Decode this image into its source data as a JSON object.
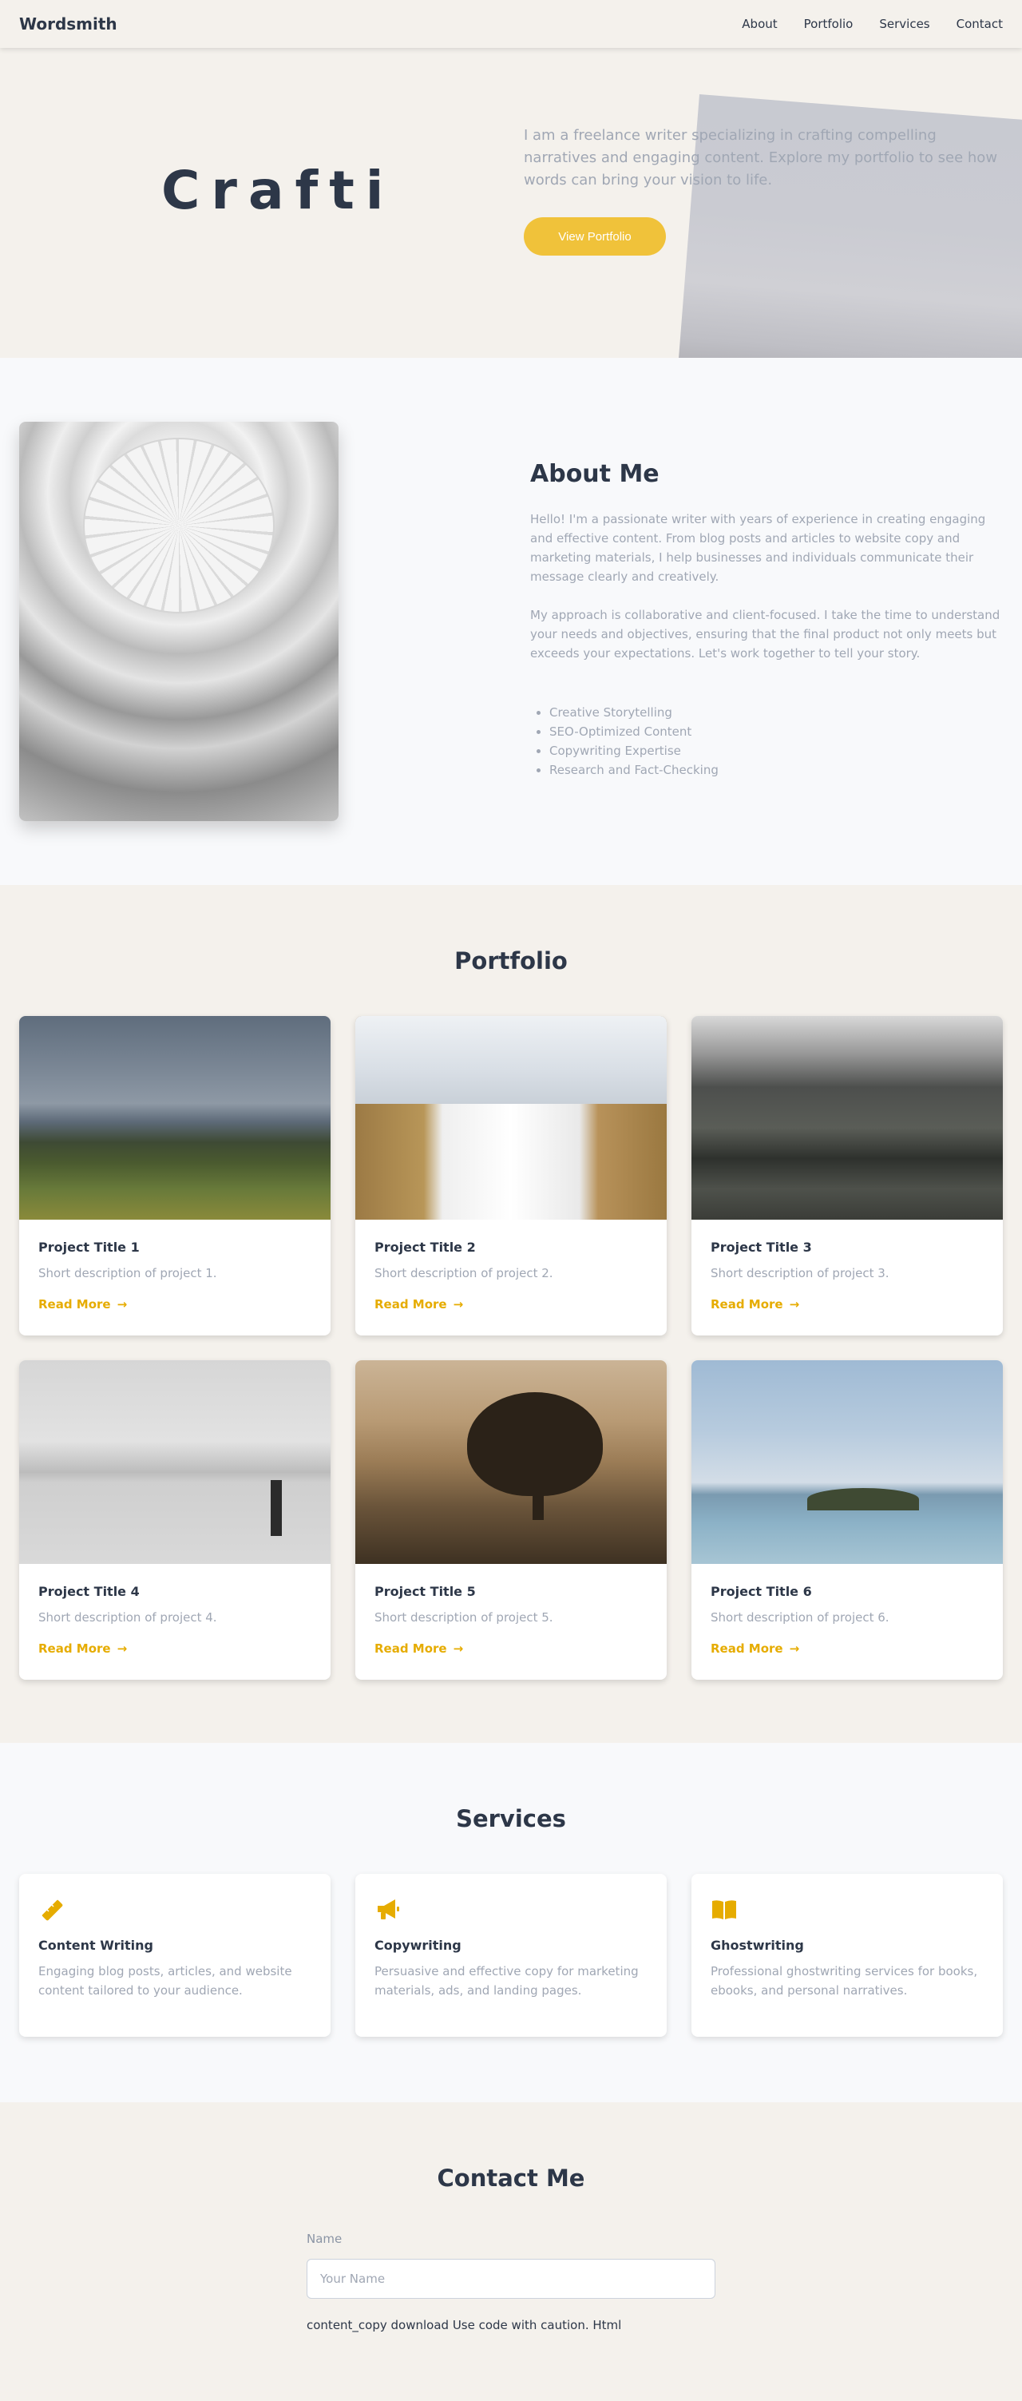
{
  "nav": {
    "brand": "Wordsmith",
    "links": [
      "About",
      "Portfolio",
      "Services",
      "Contact"
    ]
  },
  "hero": {
    "title": "Crafti",
    "text": "I am a freelance writer specializing in crafting compelling narratives and engaging content. Explore my portfolio to see how words can bring your vision to life.",
    "button": "View Portfolio"
  },
  "about": {
    "title": "About Me",
    "p1": "Hello! I'm a passionate writer with years of experience in creating engaging and effective content. From blog posts and articles to website copy and marketing materials, I help businesses and individuals communicate their message clearly and creatively.",
    "p2": "My approach is collaborative and client-focused. I take the time to understand your needs and objectives, ensuring that the final product not only meets but exceeds your expectations. Let's work together to tell your story.",
    "list": [
      "Creative Storytelling",
      "SEO-Optimized Content",
      "Copywriting Expertise",
      "Research and Fact-Checking"
    ]
  },
  "portfolio": {
    "title": "Portfolio",
    "cards": [
      {
        "title": "Project Title 1",
        "desc": "Short description of project 1.",
        "link": "Read More"
      },
      {
        "title": "Project Title 2",
        "desc": "Short description of project 2.",
        "link": "Read More"
      },
      {
        "title": "Project Title 3",
        "desc": "Short description of project 3.",
        "link": "Read More"
      },
      {
        "title": "Project Title 4",
        "desc": "Short description of project 4.",
        "link": "Read More"
      },
      {
        "title": "Project Title 5",
        "desc": "Short description of project 5.",
        "link": "Read More"
      },
      {
        "title": "Project Title 6",
        "desc": "Short description of project 6.",
        "link": "Read More"
      }
    ]
  },
  "services": {
    "title": "Services",
    "items": [
      {
        "icon": "pencil-ruler-icon",
        "title": "Content Writing",
        "desc": "Engaging blog posts, articles, and website content tailored to your audience."
      },
      {
        "icon": "megaphone-icon",
        "title": "Copywriting",
        "desc": "Persuasive and effective copy for marketing materials, ads, and landing pages."
      },
      {
        "icon": "book-open-icon",
        "title": "Ghostwriting",
        "desc": "Professional ghostwriting services for books, ebooks, and personal narratives."
      }
    ]
  },
  "contact": {
    "title": "Contact Me",
    "name_label": "Name",
    "name_placeholder": "Your Name",
    "footer": "content_copy download Use code with caution. Html"
  },
  "colors": {
    "accent": "#f0c23a",
    "link": "#e6ac00",
    "heading": "#2d3748",
    "muted": "#a0a7b4"
  }
}
